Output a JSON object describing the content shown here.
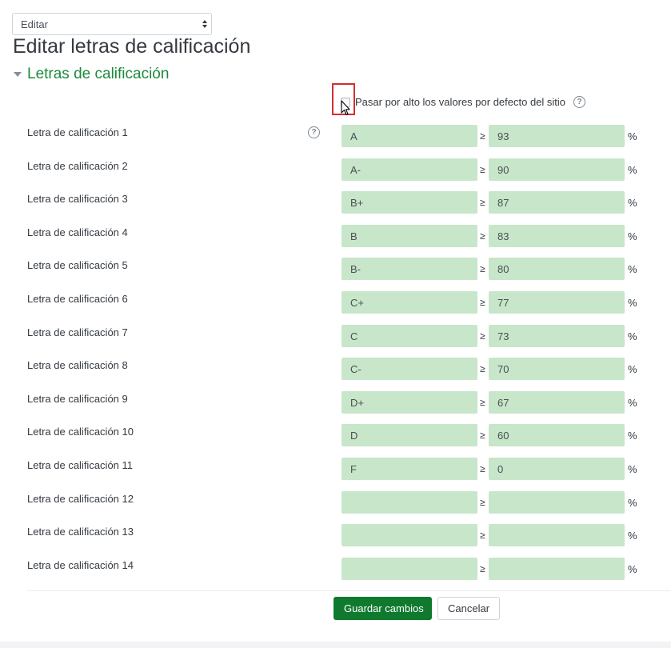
{
  "action_select": {
    "value": "Editar"
  },
  "page_title": "Editar letras de calificación",
  "section_title": "Letras de calificación",
  "override": {
    "label": "Pasar por alto los valores por defecto del sitio",
    "checked": false
  },
  "ge_symbol": "≥",
  "percent_symbol": "%",
  "help_glyph": "?",
  "rows": [
    {
      "label": "Letra de calificación 1",
      "letter": "A",
      "bound": "93"
    },
    {
      "label": "Letra de calificación 2",
      "letter": "A-",
      "bound": "90"
    },
    {
      "label": "Letra de calificación 3",
      "letter": "B+",
      "bound": "87"
    },
    {
      "label": "Letra de calificación 4",
      "letter": "B",
      "bound": "83"
    },
    {
      "label": "Letra de calificación 5",
      "letter": "B-",
      "bound": "80"
    },
    {
      "label": "Letra de calificación 6",
      "letter": "C+",
      "bound": "77"
    },
    {
      "label": "Letra de calificación 7",
      "letter": "C",
      "bound": "73"
    },
    {
      "label": "Letra de calificación 8",
      "letter": "C-",
      "bound": "70"
    },
    {
      "label": "Letra de calificación 9",
      "letter": "D+",
      "bound": "67"
    },
    {
      "label": "Letra de calificación 10",
      "letter": "D",
      "bound": "60"
    },
    {
      "label": "Letra de calificación 11",
      "letter": "F",
      "bound": "0"
    },
    {
      "label": "Letra de calificación 12",
      "letter": "",
      "bound": ""
    },
    {
      "label": "Letra de calificación 13",
      "letter": "",
      "bound": ""
    },
    {
      "label": "Letra de calificación 14",
      "letter": "",
      "bound": ""
    }
  ],
  "buttons": {
    "save": "Guardar cambios",
    "cancel": "Cancelar"
  },
  "colors": {
    "accent": "#1c8a3a",
    "primary_button": "#0f7a2e",
    "input_fill": "#c8e6c9",
    "highlight": "#d32f2f"
  }
}
